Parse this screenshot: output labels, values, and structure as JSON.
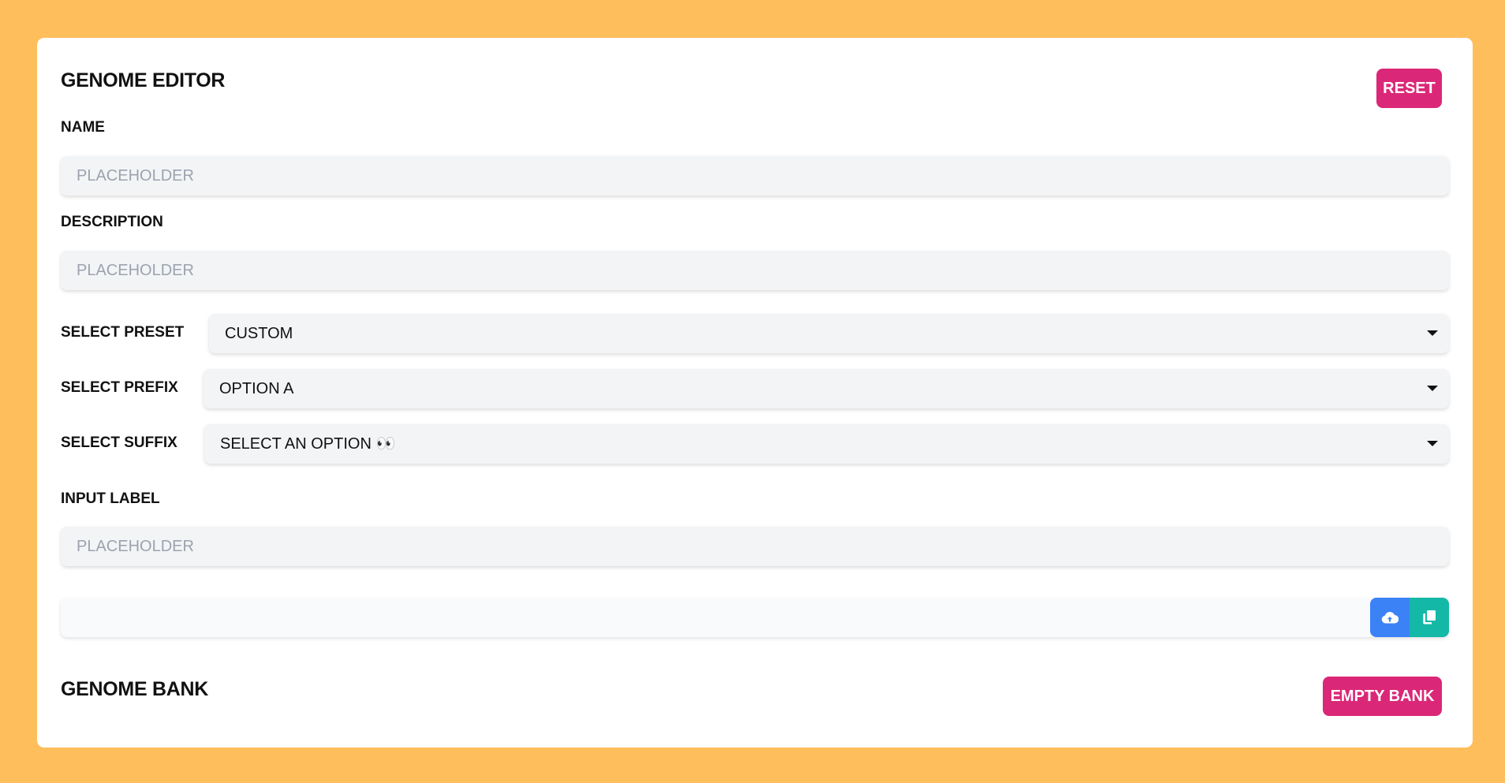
{
  "colors": {
    "background": "#FFBE5C",
    "card": "#FFFFFF",
    "accent_pink": "#DB2777",
    "upload_blue": "#3B82F6",
    "copy_teal": "#14B8A6",
    "field_bg": "#F3F4F6",
    "placeholder": "#9CA3AF"
  },
  "editor": {
    "title": "GENOME EDITOR",
    "reset_label": "RESET",
    "name": {
      "label": "NAME",
      "placeholder": "PLACEHOLDER",
      "value": ""
    },
    "description": {
      "label": "DESCRIPTION",
      "placeholder": "PLACEHOLDER",
      "value": ""
    },
    "preset": {
      "label": "SELECT PRESET",
      "selected": "CUSTOM"
    },
    "prefix": {
      "label": "SELECT PREFIX",
      "selected": "OPTION A"
    },
    "suffix": {
      "label": "SELECT SUFFIX",
      "selected": "SELECT AN OPTION 👀"
    },
    "input": {
      "label": "INPUT LABEL",
      "placeholder": "PLACEHOLDER",
      "value": ""
    },
    "output": {
      "value": "",
      "upload_icon": "cloud-upload-icon",
      "copy_icon": "copy-icon"
    }
  },
  "bank": {
    "title": "GENOME BANK",
    "empty_label": "EMPTY BANK"
  }
}
